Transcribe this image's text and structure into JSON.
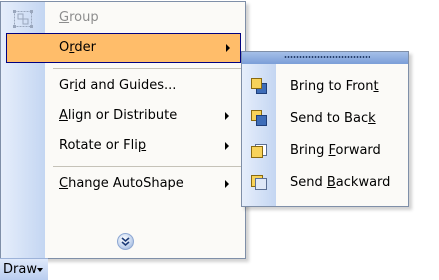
{
  "draw_menu": {
    "items": [
      {
        "pre": "",
        "key": "G",
        "post": "roup",
        "enabled": false,
        "submenu": false,
        "icon": "group-icon"
      },
      {
        "pre": "O",
        "key": "r",
        "post": "der",
        "enabled": true,
        "submenu": true,
        "highlighted": true
      },
      {
        "pre": "Gr",
        "key": "i",
        "post": "d and Guides...",
        "enabled": true,
        "submenu": false
      },
      {
        "pre": "",
        "key": "A",
        "post": "lign or Distribute",
        "enabled": true,
        "submenu": true
      },
      {
        "pre": "Rotate or Fli",
        "key": "p",
        "post": "",
        "enabled": true,
        "submenu": true
      },
      {
        "pre": "",
        "key": "C",
        "post": "hange AutoShape",
        "enabled": true,
        "submenu": true
      }
    ],
    "expand_icon": "double-chevron-down-icon"
  },
  "order_submenu": {
    "items": [
      {
        "pre": "Bring to Fron",
        "key": "t",
        "post": "",
        "icon": "bring-to-front-icon"
      },
      {
        "pre": "Send to Bac",
        "key": "k",
        "post": "",
        "icon": "send-to-back-icon"
      },
      {
        "pre": "Bring ",
        "key": "F",
        "post": "orward",
        "icon": "bring-forward-icon"
      },
      {
        "pre": "Send ",
        "key": "B",
        "post": "ackward",
        "icon": "send-backward-icon"
      }
    ]
  },
  "toolbar": {
    "draw_label": "Draw"
  },
  "colors": {
    "highlight": "#ffbd6a",
    "highlight_border": "#000080",
    "gutter_light": "#e6eefb",
    "gutter_dark": "#c4d6f2",
    "menu_bg": "#fbfaf7",
    "disabled_text": "#8d8d8d",
    "icon_yellow": "#f8d35a",
    "icon_blue": "#3e6db8"
  }
}
